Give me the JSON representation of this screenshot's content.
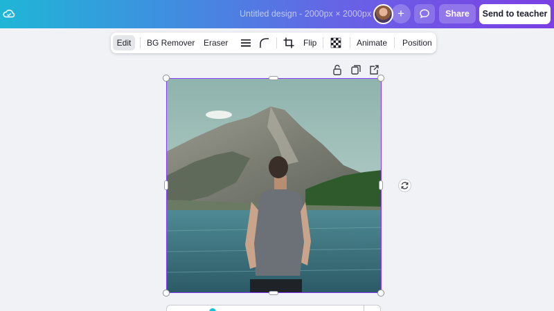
{
  "topbar": {
    "title": "Untitled design - 2000px × 2000px",
    "add_label": "+",
    "share_label": "Share",
    "send_label": "Send to teacher",
    "icons": [
      "cloud-saved-icon",
      "comment-icon"
    ]
  },
  "toolbar": {
    "edit": "Edit",
    "bg_remover": "BG Remover",
    "eraser": "Eraser",
    "flip": "Flip",
    "animate": "Animate",
    "position": "Position",
    "icons": [
      "border-weight-icon",
      "corner-rounding-icon",
      "crop-icon",
      "transparency-icon"
    ]
  },
  "element_actions": {
    "icons": [
      "lock-icon",
      "duplicate-icon",
      "share-out-icon"
    ]
  },
  "canvas": {
    "selection_color": "#8b3dff",
    "image_subject": "man-facing-mountain-lake-photo"
  },
  "colors": {
    "gradient_start": "#1fb6d6",
    "gradient_end": "#7b3fe4",
    "selection": "#8b3dff"
  }
}
